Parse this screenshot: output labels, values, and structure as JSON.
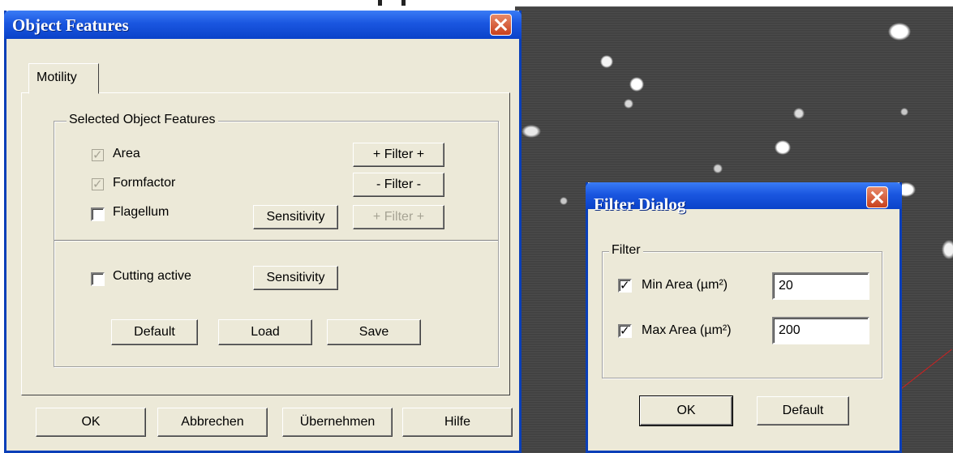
{
  "object_features": {
    "title": "Object Features",
    "tab": "Motility",
    "group_caption": "Selected Object Features",
    "features": [
      {
        "label": "Area",
        "checked": true,
        "enabled": false
      },
      {
        "label": "Formfactor",
        "checked": true,
        "enabled": false
      },
      {
        "label": "Flagellum",
        "checked": false,
        "enabled": true
      }
    ],
    "filter_plus": "+ Filter +",
    "filter_minus": "- Filter -",
    "filter_plus_disabled": "+ Filter +",
    "sensitivity": "Sensitivity",
    "cutting_label": "Cutting active",
    "cutting_sensitivity": "Sensitivity",
    "default_btn": "Default",
    "load_btn": "Load",
    "save_btn": "Save",
    "ok_btn": "OK",
    "cancel_btn": "Abbrechen",
    "apply_btn": "Übernehmen",
    "help_btn": "Hilfe"
  },
  "filter_dialog": {
    "title": "Filter Dialog",
    "group_caption": "Filter",
    "min_label": "Min Area (µm²)",
    "min_value": "20",
    "max_label": "Max Area (µm²)",
    "max_value": "200",
    "ok_btn": "OK",
    "default_btn": "Default"
  },
  "colors": {
    "titlebar": "#0a42c9",
    "dialog_bg": "#ece9d8",
    "close_button": "#c8401c"
  }
}
